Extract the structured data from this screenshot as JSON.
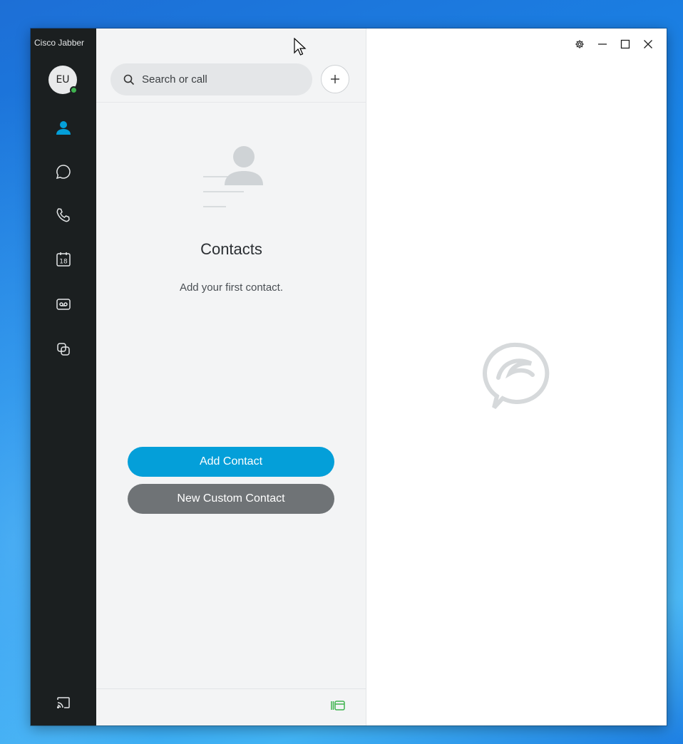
{
  "app": {
    "title": "Cisco Jabber",
    "user_initials": "EU",
    "presence_color": "#3fb34f",
    "accent_color": "#049fd9"
  },
  "nav": [
    {
      "name": "contacts",
      "icon": "person-icon",
      "active": true
    },
    {
      "name": "chats",
      "icon": "chat-bubble-icon"
    },
    {
      "name": "calls",
      "icon": "phone-icon"
    },
    {
      "name": "meetings",
      "icon": "calendar-icon",
      "badge": "18"
    },
    {
      "name": "voicemail",
      "icon": "voicemail-icon"
    },
    {
      "name": "spaces",
      "icon": "overlapping-squares-icon"
    }
  ],
  "bottom_nav": {
    "icon": "cast-icon"
  },
  "search": {
    "placeholder": "Search or call"
  },
  "contacts": {
    "title": "Contacts",
    "subtitle": "Add your first contact.",
    "add_contact_label": "Add Contact",
    "new_custom_contact_label": "New Custom Contact"
  },
  "footer": {
    "icon": "layout-panel-icon",
    "icon_color": "#3fb34f"
  },
  "window_controls": [
    "settings-gear-icon",
    "minimize-icon",
    "maximize-icon",
    "close-icon"
  ]
}
